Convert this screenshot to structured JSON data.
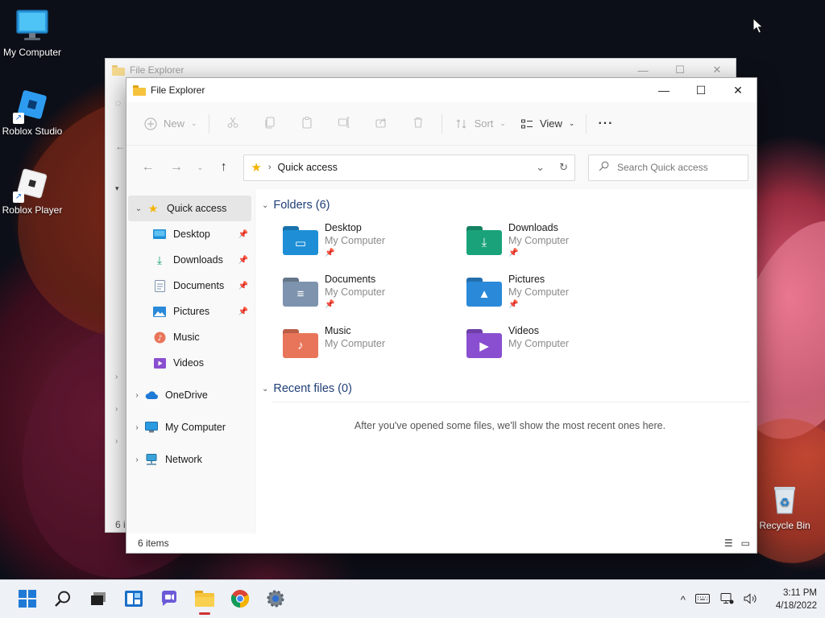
{
  "desktop": {
    "icons": [
      {
        "label": "My Computer"
      },
      {
        "label": "Roblox Studio"
      },
      {
        "label": "Roblox Player"
      },
      {
        "label": "Recycle Bin"
      }
    ]
  },
  "back_window": {
    "title": "File Explorer",
    "status_partial": "6 i"
  },
  "window": {
    "title": "File Explorer",
    "controls": {
      "minimize": "—",
      "maximize": "☐",
      "close": "✕"
    }
  },
  "toolbar": {
    "new_label": "New",
    "sort_label": "Sort",
    "view_label": "View",
    "more_label": "···"
  },
  "address": {
    "location": "Quick access",
    "search_placeholder": "Search Quick access"
  },
  "nav_pane": {
    "quick_access": "Quick access",
    "pinned": [
      {
        "label": "Desktop",
        "pinned": true
      },
      {
        "label": "Downloads",
        "pinned": true
      },
      {
        "label": "Documents",
        "pinned": true
      },
      {
        "label": "Pictures",
        "pinned": true
      },
      {
        "label": "Music",
        "pinned": false
      },
      {
        "label": "Videos",
        "pinned": false
      }
    ],
    "roots": [
      {
        "label": "OneDrive"
      },
      {
        "label": "My Computer"
      },
      {
        "label": "Network"
      }
    ]
  },
  "main": {
    "folders_heading": "Folders (6)",
    "folders": [
      {
        "name": "Desktop",
        "location": "My Computer",
        "pinned": true,
        "color": "#1e8fd6"
      },
      {
        "name": "Downloads",
        "location": "My Computer",
        "pinned": true,
        "color": "#1aa37a"
      },
      {
        "name": "Documents",
        "location": "My Computer",
        "pinned": true,
        "color": "#7e93ad"
      },
      {
        "name": "Pictures",
        "location": "My Computer",
        "pinned": true,
        "color": "#2a89d8"
      },
      {
        "name": "Music",
        "location": "My Computer",
        "pinned": false,
        "color": "#e8755a"
      },
      {
        "name": "Videos",
        "location": "My Computer",
        "pinned": false,
        "color": "#8a4fd0"
      }
    ],
    "recent_heading": "Recent files (0)",
    "recent_empty": "After you've opened some files, we'll show the most recent ones here."
  },
  "status": {
    "item_count": "6 items"
  },
  "taskbar": {
    "time": "3:11 PM",
    "date": "4/18/2022"
  }
}
